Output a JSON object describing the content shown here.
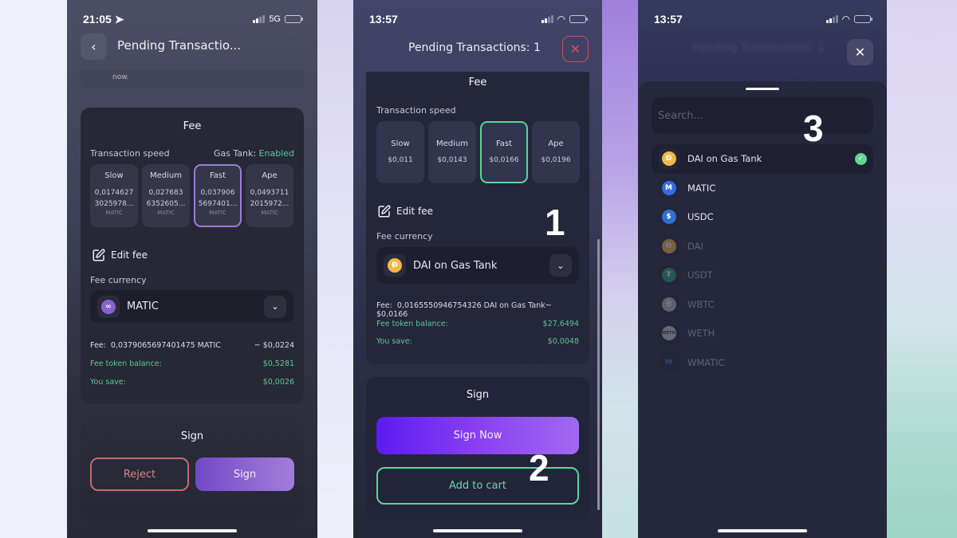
{
  "phone1": {
    "status": {
      "time": "21:05",
      "network": "5G"
    },
    "header": {
      "title": "Pending Transactio...",
      "back_icon": "chevron-left-icon"
    },
    "faded_text": "now.",
    "fee_card": {
      "title": "Fee",
      "speed_label": "Transaction speed",
      "gas_tank_label": "Gas Tank:",
      "gas_tank_status": "Enabled",
      "speeds": [
        {
          "name": "Slow",
          "line1": "0,0174627",
          "line2": "3025978...",
          "unit": "MATIC",
          "selected": false
        },
        {
          "name": "Medium",
          "line1": "0,027683",
          "line2": "6352605...",
          "unit": "MATIC",
          "selected": false
        },
        {
          "name": "Fast",
          "line1": "0,037906",
          "line2": "5697401...",
          "unit": "MATIC",
          "selected": true
        },
        {
          "name": "Ape",
          "line1": "0,0493711",
          "line2": "2015972...",
          "unit": "MATIC",
          "selected": false
        }
      ],
      "edit_fee": "Edit fee",
      "fee_currency_label": "Fee currency",
      "currency": "MATIC",
      "fee_label": "Fee:",
      "fee_value": "0,0379065697401475 MATIC",
      "fee_usd": "~ $0,0224",
      "balance_label": "Fee token balance:",
      "balance_value": "$0,5281",
      "save_label": "You save:",
      "save_value": "$0,0026"
    },
    "sign_card": {
      "title": "Sign",
      "reject": "Reject",
      "sign": "Sign"
    }
  },
  "phone2": {
    "status": {
      "time": "13:57"
    },
    "header": {
      "title": "Pending Transactions: 1",
      "close_icon": "close-icon"
    },
    "fee_card": {
      "title": "Fee",
      "speed_label": "Transaction speed",
      "speeds": [
        {
          "name": "Slow",
          "value": "$0,011",
          "selected": false
        },
        {
          "name": "Medium",
          "value": "$0,0143",
          "selected": false
        },
        {
          "name": "Fast",
          "value": "$0,0166",
          "selected": true
        },
        {
          "name": "Ape",
          "value": "$0,0196",
          "selected": false
        }
      ],
      "edit_fee": "Edit fee",
      "fee_currency_label": "Fee currency",
      "currency": "DAI on Gas Tank",
      "fee_label": "Fee:",
      "fee_value": "0,0165550946754326 DAI on Gas Tank",
      "fee_usd": "~ $0,0166",
      "balance_label": "Fee token balance:",
      "balance_value": "$27,6494",
      "save_label": "You save:",
      "save_value": "$0,0048"
    },
    "sign_card": {
      "title": "Sign",
      "sign_now": "Sign Now",
      "add_to_cart": "Add to cart"
    },
    "annotations": {
      "one": "1",
      "two": "2"
    }
  },
  "phone3": {
    "status": {
      "time": "13:57"
    },
    "blurred_title": "Pending Transactions: 1",
    "search_placeholder": "Search...",
    "tokens": [
      {
        "name": "DAI on Gas Tank",
        "icon": "dai-icon",
        "selected": true,
        "enabled": true
      },
      {
        "name": "MATIC",
        "icon": "matic-icon",
        "selected": false,
        "enabled": true
      },
      {
        "name": "USDC",
        "icon": "usdc-icon",
        "selected": false,
        "enabled": true
      },
      {
        "name": "DAI",
        "icon": "dai-icon",
        "selected": false,
        "enabled": false
      },
      {
        "name": "USDT",
        "icon": "usdt-icon",
        "selected": false,
        "enabled": false
      },
      {
        "name": "WBTC",
        "icon": "wbtc-icon",
        "selected": false,
        "enabled": false
      },
      {
        "name": "WETH",
        "icon": "weth-icon",
        "selected": false,
        "enabled": false
      },
      {
        "name": "WMATIC",
        "icon": "wmatic-icon",
        "selected": false,
        "enabled": false
      }
    ],
    "annotations": {
      "three": "3"
    }
  },
  "colors": {
    "accent_green": "#5fd59a",
    "accent_purple": "#9b7ed6",
    "danger": "#e8485b",
    "sign_gradient_start": "#5a1cf0",
    "sign_gradient_end": "#a06af0"
  }
}
